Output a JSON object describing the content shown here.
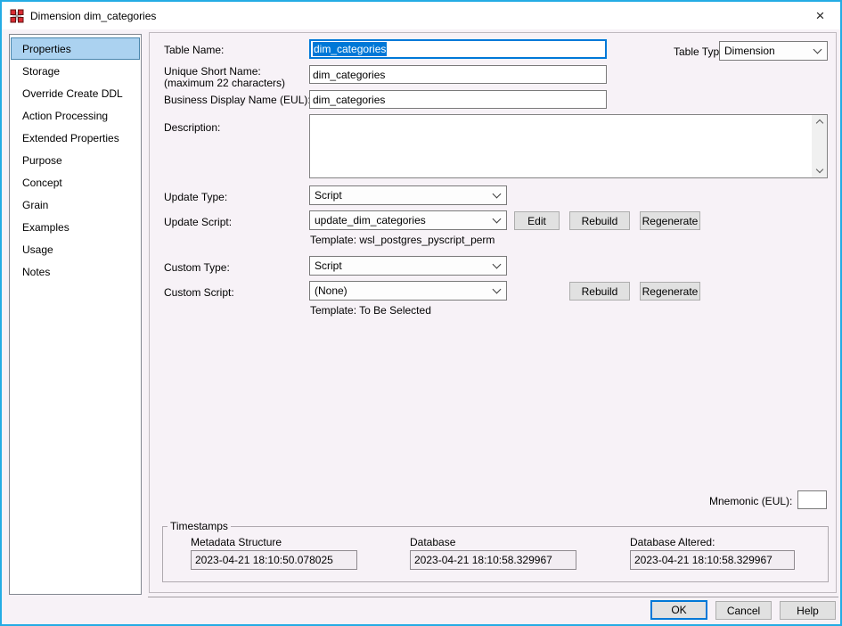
{
  "window": {
    "title": "Dimension dim_categories",
    "close_glyph": "×"
  },
  "colors": {
    "window_border": "#24ace4",
    "selection_bg": "#abd2f0",
    "selection_border": "#4a86ad",
    "focus_blue": "#0078d7",
    "panel_bg": "#f7f2f7",
    "selected_text_bg": "#0078d7"
  },
  "sidebar": {
    "items": [
      {
        "label": "Properties",
        "selected": true
      },
      {
        "label": "Storage",
        "selected": false
      },
      {
        "label": "Override Create DDL",
        "selected": false
      },
      {
        "label": "Action Processing",
        "selected": false
      },
      {
        "label": "Extended Properties",
        "selected": false
      },
      {
        "label": "Purpose",
        "selected": false
      },
      {
        "label": "Concept",
        "selected": false
      },
      {
        "label": "Grain",
        "selected": false
      },
      {
        "label": "Examples",
        "selected": false
      },
      {
        "label": "Usage",
        "selected": false
      },
      {
        "label": "Notes",
        "selected": false
      }
    ]
  },
  "form": {
    "table_name": {
      "label": "Table Name:",
      "value": "dim_categories"
    },
    "table_type": {
      "label": "Table Type:",
      "value": "Dimension"
    },
    "unique_short_name": {
      "label": "Unique Short Name:",
      "label2": "(maximum 22 characters)",
      "value": "dim_categories"
    },
    "business_display_name": {
      "label": "Business Display Name (EUL):",
      "value": "dim_categories"
    },
    "description": {
      "label": "Description:",
      "value": ""
    },
    "update_type": {
      "label": "Update Type:",
      "value": "Script"
    },
    "update_script": {
      "label": "Update Script:",
      "value": "update_dim_categories",
      "buttons": [
        "Edit",
        "Rebuild",
        "Regenerate"
      ],
      "template": "Template: wsl_postgres_pyscript_perm"
    },
    "custom_type": {
      "label": "Custom Type:",
      "value": "Script"
    },
    "custom_script": {
      "label": "Custom Script:",
      "value": "(None)",
      "buttons": [
        "Rebuild",
        "Regenerate"
      ],
      "template": "Template: To Be Selected"
    },
    "mnemonic": {
      "label": "Mnemonic (EUL):",
      "value": ""
    }
  },
  "timestamps": {
    "legend": "Timestamps",
    "fields": [
      {
        "label": "Metadata Structure",
        "value": "2023-04-21 18:10:50.078025"
      },
      {
        "label": "Database",
        "value": "2023-04-21 18:10:58.329967"
      },
      {
        "label": "Database Altered:",
        "value": "2023-04-21 18:10:58.329967"
      }
    ]
  },
  "footer": {
    "ok_label": "OK",
    "cancel_label": "Cancel",
    "help_label": "Help"
  }
}
